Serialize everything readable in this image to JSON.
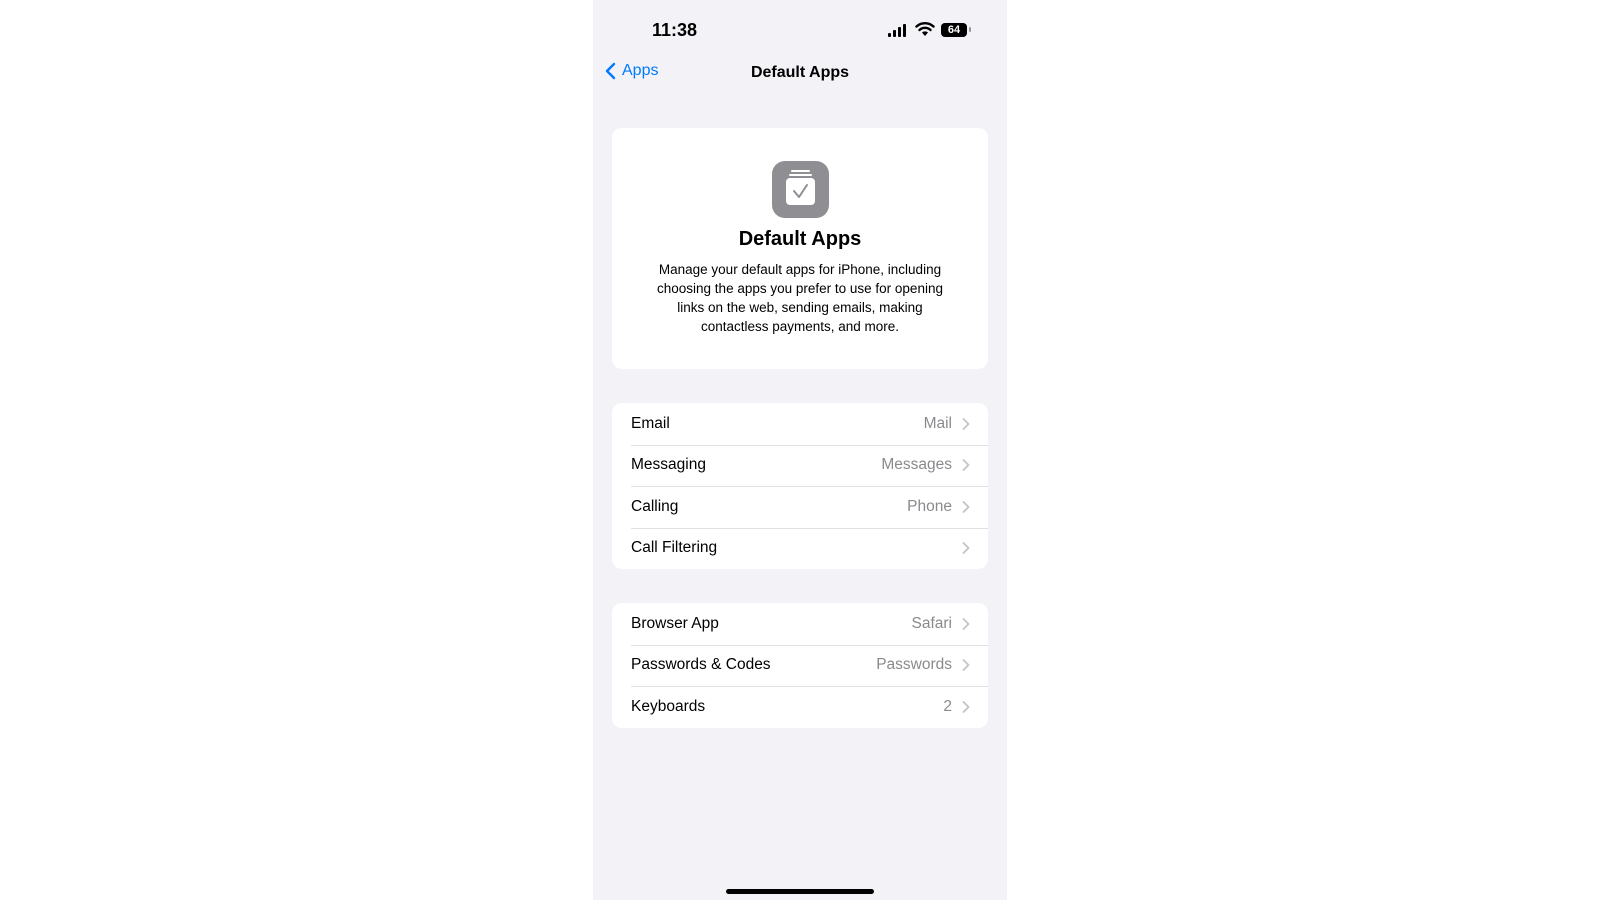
{
  "status_bar": {
    "time": "11:38",
    "battery": "64"
  },
  "nav": {
    "back_label": "Apps",
    "title": "Default Apps"
  },
  "hero": {
    "icon": "default-apps-icon",
    "title": "Default Apps",
    "description": "Manage your default apps for iPhone, including choosing the apps you prefer to use for opening links on the web, sending emails, making contactless payments, and more."
  },
  "groups": [
    {
      "rows": [
        {
          "label": "Email",
          "value": "Mail"
        },
        {
          "label": "Messaging",
          "value": "Messages"
        },
        {
          "label": "Calling",
          "value": "Phone"
        },
        {
          "label": "Call Filtering",
          "value": ""
        }
      ]
    },
    {
      "rows": [
        {
          "label": "Browser App",
          "value": "Safari"
        },
        {
          "label": "Passwords & Codes",
          "value": "Passwords"
        },
        {
          "label": "Keyboards",
          "value": "2"
        }
      ]
    }
  ],
  "colors": {
    "accent": "#007aff",
    "background": "#f2f2f7",
    "icon_gray": "#8e8e93"
  }
}
